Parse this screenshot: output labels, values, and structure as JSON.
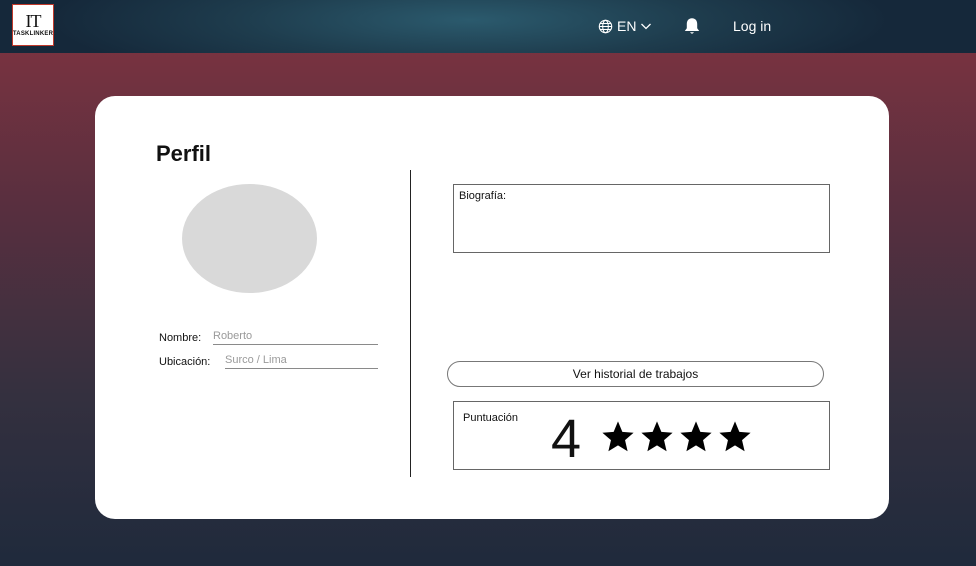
{
  "header": {
    "logo_mark": "IT",
    "logo_word": "TASKLINKER",
    "language": "EN",
    "login_label": "Log in"
  },
  "profile": {
    "title": "Perfil",
    "fields": [
      {
        "label": "Nombre:",
        "value": "Roberto"
      },
      {
        "label": "Ubicación:",
        "value": "Surco / Lima"
      }
    ],
    "biography_label": "Biografía:",
    "history_button": "Ver historial de trabajos",
    "rating": {
      "label": "Puntuación",
      "value": "4",
      "stars": 4
    }
  },
  "colors": {
    "header_bg": "#1e3c4d",
    "background_top": "#823440",
    "background_bottom": "#1f2a3c",
    "avatar_placeholder": "#d9d9d9"
  },
  "icons": [
    "globe-icon",
    "chevron-down-icon",
    "bell-icon",
    "star-icon"
  ]
}
